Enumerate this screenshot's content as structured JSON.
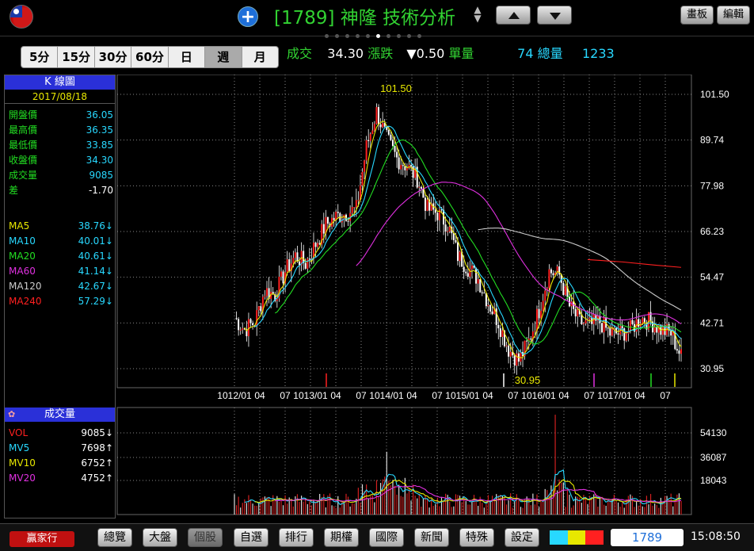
{
  "header": {
    "stock_code": "[1789]",
    "stock_name": "神隆",
    "page_name": "技術分析",
    "stepper": "▲\n▼",
    "board_label": "畫板",
    "edit_label": "編輯",
    "page_dots": 10,
    "active_dot": 5
  },
  "periods": [
    "5分",
    "15分",
    "30分",
    "60分",
    "日",
    "週",
    "月"
  ],
  "active_period": "週",
  "quote": {
    "trade_label": "成交",
    "trade_value": "34.30",
    "change_label": "漲跌",
    "change_value": "▼0.50",
    "unit_vol_label": "單量",
    "unit_vol_value": "74",
    "total_vol_label": "總量",
    "total_vol_value": "1233"
  },
  "kpanel": {
    "title": "K 線圖",
    "date": "2017/08/18",
    "rows": [
      {
        "k": "開盤價",
        "v": "36.05"
      },
      {
        "k": "最高價",
        "v": "36.35"
      },
      {
        "k": "最低價",
        "v": "33.85"
      },
      {
        "k": "收盤價",
        "v": "34.30"
      },
      {
        "k": "成交量",
        "v": "9085"
      },
      {
        "k": "差",
        "v": "-1.70"
      }
    ],
    "ma": [
      {
        "k": "MA5",
        "v": "38.76↓",
        "color": "#e8e800"
      },
      {
        "k": "MA10",
        "v": "40.01↓",
        "color": "#28d8ff"
      },
      {
        "k": "MA20",
        "v": "40.61↓",
        "color": "#22dd22"
      },
      {
        "k": "MA60",
        "v": "41.14↓",
        "color": "#e030e0"
      },
      {
        "k": "MA120",
        "v": "42.67↓",
        "color": "#cccccc"
      },
      {
        "k": "MA240",
        "v": "57.29↓",
        "color": "#ff2020"
      }
    ]
  },
  "volpanel": {
    "title": "成交量",
    "rows": [
      {
        "k": "VOL",
        "v": "9085↓",
        "color": "#ff2020"
      },
      {
        "k": "MV5",
        "v": "7698↑",
        "color": "#28d8ff"
      },
      {
        "k": "MV10",
        "v": "6752↑",
        "color": "#e8e800"
      },
      {
        "k": "MV20",
        "v": "4752↑",
        "color": "#e030e0"
      }
    ]
  },
  "chart_data": {
    "type": "line",
    "price_axis": [
      "101.50",
      "89.74",
      "77.98",
      "66.23",
      "54.47",
      "42.71",
      "30.95"
    ],
    "price_range": [
      30.95,
      101.5
    ],
    "volume_axis": [
      "54130",
      "36087",
      "18043"
    ],
    "x_labels": [
      "1012/01",
      "04",
      "07",
      "1013/01",
      "04",
      "07",
      "1014/01",
      "04",
      "07",
      "1015/01",
      "04",
      "07",
      "1016/01",
      "04",
      "07",
      "1017/01",
      "04",
      "07"
    ],
    "high_marker": "101.50",
    "low_marker": "30.95",
    "series": [
      {
        "name": "MA5",
        "color": "#e8e800"
      },
      {
        "name": "MA10",
        "color": "#28d8ff"
      },
      {
        "name": "MA20",
        "color": "#22dd22"
      },
      {
        "name": "MA60",
        "color": "#e030e0"
      },
      {
        "name": "MA120",
        "color": "#cccccc"
      },
      {
        "name": "MA240",
        "color": "#ff2020"
      }
    ],
    "close_profile": [
      [
        0,
        44
      ],
      [
        5,
        41
      ],
      [
        10,
        43
      ],
      [
        15,
        51
      ],
      [
        20,
        50
      ],
      [
        25,
        56
      ],
      [
        30,
        60
      ],
      [
        35,
        58
      ],
      [
        40,
        63
      ],
      [
        45,
        68
      ],
      [
        50,
        70
      ],
      [
        55,
        71
      ],
      [
        60,
        72
      ],
      [
        65,
        88
      ],
      [
        70,
        97
      ],
      [
        75,
        90
      ],
      [
        80,
        85
      ],
      [
        85,
        83
      ],
      [
        90,
        80
      ],
      [
        95,
        72
      ],
      [
        100,
        71
      ],
      [
        105,
        68
      ],
      [
        110,
        60
      ],
      [
        115,
        57
      ],
      [
        120,
        54
      ],
      [
        125,
        48
      ],
      [
        130,
        43
      ],
      [
        135,
        36
      ],
      [
        140,
        33
      ],
      [
        145,
        38
      ],
      [
        150,
        46
      ],
      [
        155,
        56
      ],
      [
        160,
        55
      ],
      [
        165,
        47
      ],
      [
        170,
        43
      ],
      [
        175,
        42
      ],
      [
        180,
        43
      ],
      [
        185,
        40
      ],
      [
        190,
        40
      ],
      [
        195,
        41
      ],
      [
        200,
        44
      ],
      [
        205,
        43
      ],
      [
        210,
        41
      ],
      [
        215,
        40
      ],
      [
        220,
        34
      ]
    ]
  },
  "bottom": {
    "brand": "贏家行",
    "nav": [
      "總覽",
      "大盤",
      "個股",
      "自選",
      "排行",
      "期權",
      "國際",
      "新聞",
      "特殊",
      "設定"
    ],
    "active_nav": "個股",
    "colorbar": [
      "#28d8ff",
      "#e8e800",
      "#ff2020"
    ],
    "code_input": "1789",
    "clock": "15:08:50"
  }
}
